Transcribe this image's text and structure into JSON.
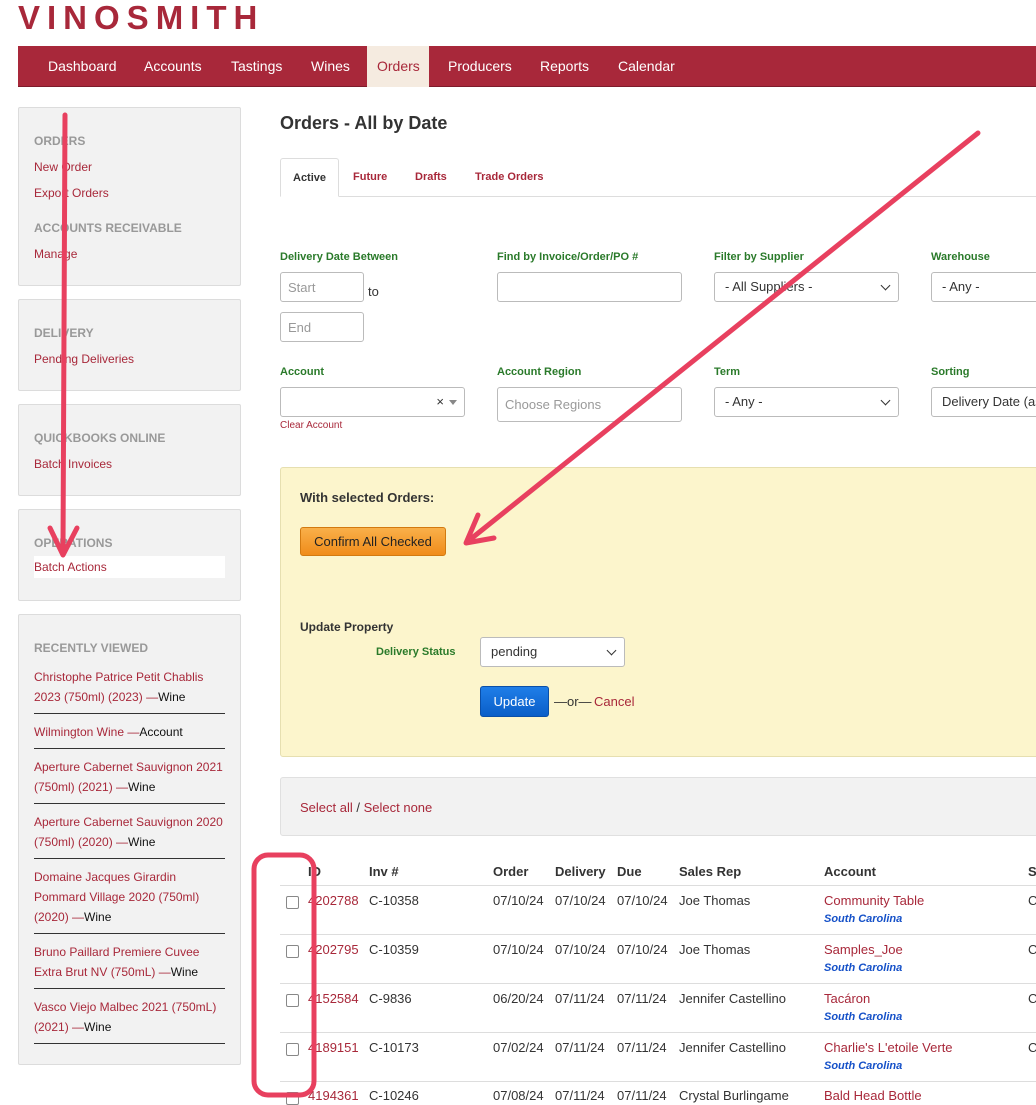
{
  "brand": {
    "logo_text": "VINOSMITH"
  },
  "nav": {
    "items": [
      "Dashboard",
      "Accounts",
      "Tastings",
      "Wines",
      "Orders",
      "Producers",
      "Reports",
      "Calendar"
    ],
    "active": "Orders"
  },
  "sidebar": {
    "orders": {
      "heading": "ORDERS",
      "links": [
        "New Order",
        "Export Orders"
      ]
    },
    "ar": {
      "heading": "ACCOUNTS RECEIVABLE",
      "links": [
        "Manage"
      ]
    },
    "delivery": {
      "heading": "DELIVERY",
      "links": [
        "Pending Deliveries"
      ]
    },
    "qbo": {
      "heading": "QUICKBOOKS ONLINE",
      "links": [
        "Batch Invoices"
      ]
    },
    "operations": {
      "heading": "OPERATIONS",
      "links": [
        "Batch Actions"
      ]
    },
    "recent": {
      "heading": "RECENTLY VIEWED",
      "items": [
        {
          "name": "Christophe Patrice Petit Chablis 2023 (750ml) (2023)",
          "kind": "Wine"
        },
        {
          "name": "Wilmington Wine",
          "kind": "Account"
        },
        {
          "name": "Aperture Cabernet Sauvignon 2021 (750ml) (2021)",
          "kind": "Wine"
        },
        {
          "name": "Aperture Cabernet Sauvignon 2020 (750ml) (2020)",
          "kind": "Wine"
        },
        {
          "name": "Domaine Jacques Girardin Pommard Village 2020 (750ml) (2020)",
          "kind": "Wine"
        },
        {
          "name": "Bruno Paillard Premiere Cuvee Extra Brut NV (750mL)",
          "kind": "Wine"
        },
        {
          "name": "Vasco Viejo Malbec 2021 (750mL) (2021)",
          "kind": "Wine"
        }
      ],
      "separator": " —"
    }
  },
  "main": {
    "title": "Orders - All by Date",
    "tabs": [
      "Active",
      "Future",
      "Drafts",
      "Trade Orders"
    ],
    "active_tab": "Active",
    "filters": {
      "delivery_label": "Delivery Date Between",
      "start_placeholder": "Start",
      "to_text": "to",
      "end_placeholder": "End",
      "invoice_label": "Find by Invoice/Order/PO #",
      "invoice_value": "",
      "supplier_label": "Filter by Supplier",
      "supplier_value": "- All Suppliers -",
      "warehouse_label": "Warehouse",
      "warehouse_value": "- Any -",
      "account_label": "Account",
      "account_clear_glyph": "×",
      "clear_account": "Clear Account",
      "region_label": "Account Region",
      "region_placeholder": "Choose Regions",
      "term_label": "Term",
      "term_value": "- Any -",
      "sorting_label": "Sorting",
      "sorting_value": "Delivery Date (as"
    },
    "batch": {
      "title": "With selected Orders:",
      "confirm_button": "Confirm All Checked",
      "update_property_label": "Update Property",
      "delivery_status_label": "Delivery Status",
      "delivery_status_value": "pending",
      "update_button": "Update",
      "or_text": "—or—",
      "cancel_link": "Cancel"
    },
    "select": {
      "all": "Select all",
      "sep": " / ",
      "none": "Select none"
    },
    "table": {
      "columns": [
        "ID",
        "Inv #",
        "Order",
        "Delivery",
        "Due",
        "Sales Rep",
        "Account",
        "S"
      ],
      "rows": [
        {
          "id": "4202788",
          "inv": "C-10358",
          "order": "07/10/24",
          "delivery": "07/10/24",
          "due": "07/10/24",
          "rep": "Joe Thomas",
          "account": "Community Table",
          "region": "South Carolina",
          "s": "C"
        },
        {
          "id": "4202795",
          "inv": "C-10359",
          "order": "07/10/24",
          "delivery": "07/10/24",
          "due": "07/10/24",
          "rep": "Joe Thomas",
          "account": "Samples_Joe",
          "region": "South Carolina",
          "s": "C"
        },
        {
          "id": "4152584",
          "inv": "C-9836",
          "order": "06/20/24",
          "delivery": "07/11/24",
          "due": "07/11/24",
          "rep": "Jennifer Castellino",
          "account": "Tacáron",
          "region": "South Carolina",
          "s": "C"
        },
        {
          "id": "4189151",
          "inv": "C-10173",
          "order": "07/02/24",
          "delivery": "07/11/24",
          "due": "07/11/24",
          "rep": "Jennifer Castellino",
          "account": "Charlie's L'etoile Verte",
          "region": "South Carolina",
          "s": "C"
        },
        {
          "id": "4194361",
          "inv": "C-10246",
          "order": "07/08/24",
          "delivery": "07/11/24",
          "due": "07/11/24",
          "rep": "Crystal Burlingame",
          "account": "Bald Head Bottle",
          "region": "",
          "s": ""
        }
      ]
    }
  },
  "annotation_color": "#e8405f"
}
